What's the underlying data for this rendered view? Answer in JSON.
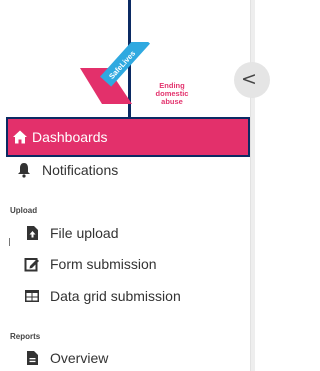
{
  "logo": {
    "ribbon_text": "SafeLives",
    "tagline_lines": [
      "Ending",
      "domestic",
      "abuse"
    ]
  },
  "sidebar": {
    "collapse_glyph": "<",
    "items": [
      {
        "label": "Dashboards",
        "icon": "home-icon",
        "active": true
      },
      {
        "label": "Notifications",
        "icon": "bell-icon",
        "active": false
      }
    ],
    "sections": [
      {
        "title": "Upload",
        "items": [
          {
            "label": "File upload",
            "icon": "file-upload-icon"
          },
          {
            "label": "Form submission",
            "icon": "edit-form-icon"
          },
          {
            "label": "Data grid submission",
            "icon": "table-grid-icon"
          }
        ]
      },
      {
        "title": "Reports",
        "items": [
          {
            "label": "Overview",
            "icon": "document-icon"
          }
        ]
      }
    ]
  },
  "colors": {
    "brand_pink": "#e3306b",
    "brand_blue": "#2fa9e0",
    "highlight_navy": "#0b2a63",
    "text_dark": "#333333"
  }
}
